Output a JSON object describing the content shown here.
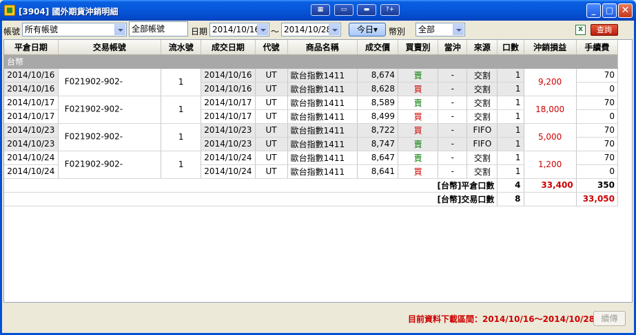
{
  "window": {
    "title": "[3904] 國外期貨沖銷明細",
    "toolbar_icons": [
      "layout-icon",
      "screen-icon",
      "window-icon",
      "help-icon"
    ],
    "help_label": "?+"
  },
  "filters": {
    "account_label": "帳號",
    "account_value": "所有帳號",
    "account_text": "全部帳號",
    "date_label": "日期",
    "date_from": "2014/10/16",
    "date_sep": "～",
    "date_to": "2014/10/28",
    "today_button": "今日▾",
    "currency_label": "幣別",
    "currency_value": "全部",
    "query_button": "查詢"
  },
  "table": {
    "headers": [
      "平倉日期",
      "交易帳號",
      "流水號",
      "成交日期",
      "代號",
      "商品名稱",
      "成交價",
      "買賣別",
      "當沖",
      "來源",
      "口數",
      "沖銷損益",
      "手續費"
    ],
    "group_label": "台幣",
    "rows": [
      {
        "close_date": "2014/10/16",
        "account": "F021902-902-",
        "serial": "1",
        "trade_date": "2014/10/16",
        "code": "UT",
        "product": "歐台指數1411",
        "price": "8,674",
        "side": "賣",
        "daytrade": "-",
        "source": "交割",
        "qty": "1",
        "pnl": "9,200",
        "fee": "70"
      },
      {
        "close_date": "2014/10/16",
        "account": "",
        "serial": "",
        "trade_date": "2014/10/16",
        "code": "UT",
        "product": "歐台指數1411",
        "price": "8,628",
        "side": "買",
        "daytrade": "-",
        "source": "交割",
        "qty": "1",
        "pnl": "",
        "fee": "0"
      },
      {
        "close_date": "2014/10/17",
        "account": "F021902-902-",
        "serial": "1",
        "trade_date": "2014/10/17",
        "code": "UT",
        "product": "歐台指數1411",
        "price": "8,589",
        "side": "賣",
        "daytrade": "-",
        "source": "交割",
        "qty": "1",
        "pnl": "18,000",
        "fee": "70"
      },
      {
        "close_date": "2014/10/17",
        "account": "",
        "serial": "",
        "trade_date": "2014/10/17",
        "code": "UT",
        "product": "歐台指數1411",
        "price": "8,499",
        "side": "買",
        "daytrade": "-",
        "source": "交割",
        "qty": "1",
        "pnl": "",
        "fee": "0"
      },
      {
        "close_date": "2014/10/23",
        "account": "F021902-902-",
        "serial": "1",
        "trade_date": "2014/10/23",
        "code": "UT",
        "product": "歐台指數1411",
        "price": "8,722",
        "side": "買",
        "daytrade": "-",
        "source": "FIFO",
        "qty": "1",
        "pnl": "5,000",
        "fee": "70"
      },
      {
        "close_date": "2014/10/23",
        "account": "",
        "serial": "",
        "trade_date": "2014/10/23",
        "code": "UT",
        "product": "歐台指數1411",
        "price": "8,747",
        "side": "賣",
        "daytrade": "-",
        "source": "FIFO",
        "qty": "1",
        "pnl": "",
        "fee": "70"
      },
      {
        "close_date": "2014/10/24",
        "account": "F021902-902-",
        "serial": "1",
        "trade_date": "2014/10/24",
        "code": "UT",
        "product": "歐台指數1411",
        "price": "8,647",
        "side": "賣",
        "daytrade": "-",
        "source": "交割",
        "qty": "1",
        "pnl": "1,200",
        "fee": "70"
      },
      {
        "close_date": "2014/10/24",
        "account": "",
        "serial": "",
        "trade_date": "2014/10/24",
        "code": "UT",
        "product": "歐台指數1411",
        "price": "8,641",
        "side": "買",
        "daytrade": "-",
        "source": "交割",
        "qty": "1",
        "pnl": "",
        "fee": "0"
      }
    ],
    "summary": [
      {
        "label": "[台幣]平倉口數",
        "qty": "4",
        "pnl": "33,400",
        "fee": "350"
      },
      {
        "label": "[台幣]交易口數",
        "qty": "8",
        "pnl": "",
        "fee": "33,050"
      }
    ]
  },
  "status": {
    "download_range": "目前資料下載區間：2014/10/16～2014/10/28",
    "continue_button": "續傳"
  },
  "colors": {
    "buy": "#cc0000",
    "sell": "#007a00",
    "pnl": "#cc0000",
    "titlebar": "#0656d8"
  }
}
